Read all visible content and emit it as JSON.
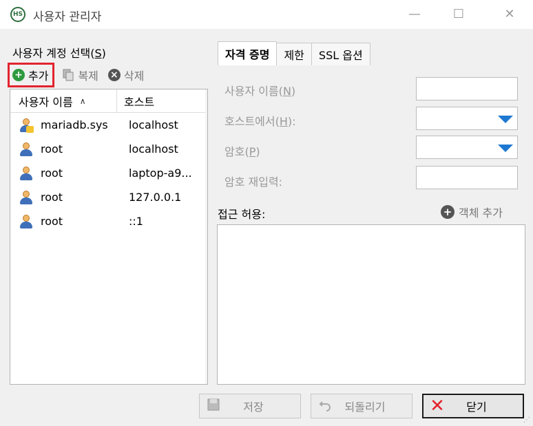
{
  "window": {
    "title": "사용자 관리자",
    "icon_text": "HS",
    "minimize_glyph": "—",
    "maximize_glyph": "☐",
    "close_glyph": "✕"
  },
  "account_select": {
    "label_prefix": "사용자 계정 선택(",
    "label_key": "S",
    "label_suffix": ")"
  },
  "toolbar": {
    "add_label": "추가",
    "copy_label": "복제",
    "delete_label": "삭제"
  },
  "user_list": {
    "columns": {
      "user": "사용자 이름",
      "host": "호스트"
    },
    "rows": [
      {
        "user": "mariadb.sys",
        "host": "localhost"
      },
      {
        "user": "root",
        "host": "localhost"
      },
      {
        "user": "root",
        "host": "laptop-a9..."
      },
      {
        "user": "root",
        "host": "127.0.0.1"
      },
      {
        "user": "root",
        "host": "::1"
      }
    ]
  },
  "tabs": [
    {
      "label": "자격 증명",
      "active": true
    },
    {
      "label": "제한",
      "active": false
    },
    {
      "label": "SSL 옵션",
      "active": false
    }
  ],
  "credentials": {
    "username": {
      "label": "사용자 이름(",
      "key": "N",
      "suffix": ")",
      "value": ""
    },
    "from_host": {
      "label": "호스트에서(",
      "key": "H",
      "suffix": "):",
      "value": ""
    },
    "password": {
      "label": "암호(",
      "key": "P",
      "suffix": ")",
      "value": ""
    },
    "password_repeat": {
      "label": "암호 재입력:",
      "value": ""
    }
  },
  "access": {
    "label": "접근 허용:",
    "add_object_label": "객체 추가"
  },
  "buttons": {
    "save": "저장",
    "revert": "되돌리기",
    "close": "닫기"
  },
  "colors": {
    "highlight": "#e3232e",
    "dropdown_arrow": "#1e78d2",
    "add_icon": "#2e9a3e"
  }
}
